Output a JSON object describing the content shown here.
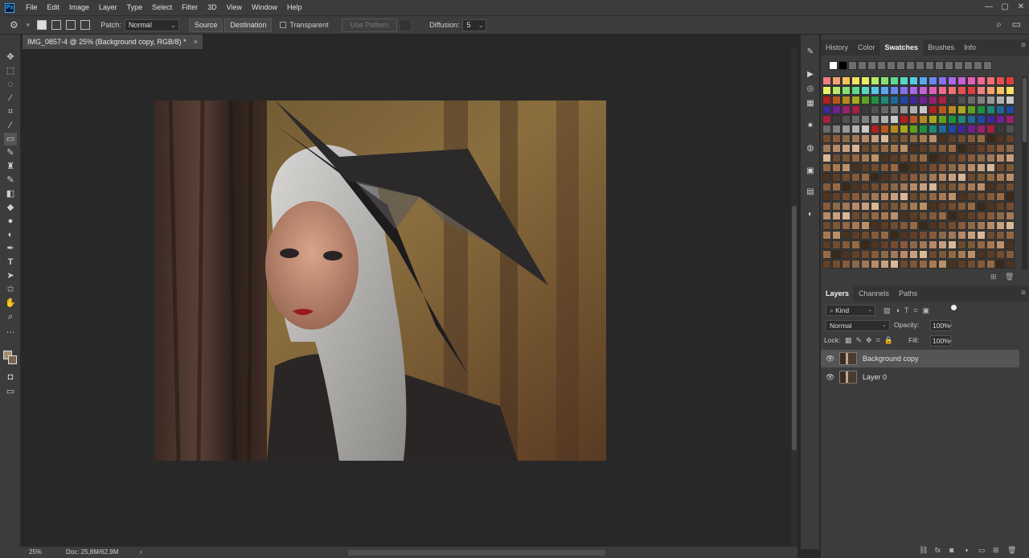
{
  "app": {
    "logo": "Ps"
  },
  "menu": [
    "File",
    "Edit",
    "Image",
    "Layer",
    "Type",
    "Select",
    "Filter",
    "3D",
    "View",
    "Window",
    "Help"
  ],
  "window_controls": {
    "minimize": "—",
    "maximize": "▢",
    "close": "✕"
  },
  "options": {
    "patch_label": "Patch:",
    "patch_mode": "Normal",
    "source": "Source",
    "destination": "Destination",
    "transparent": "Transparent",
    "use_pattern": "Use Pattern",
    "diffusion_label": "Diffusion:",
    "diffusion_value": "5"
  },
  "document": {
    "tab_title": "IMG_0857-4 @ 25% (Background copy, RGB/8) *",
    "close": "×"
  },
  "status": {
    "zoom": "25%",
    "doc": "Doc: 25,8M/62,9M",
    "arrow": "›"
  },
  "swatch_panel": {
    "tabs": [
      "History",
      "Color",
      "Swatches",
      "Brushes",
      "Info"
    ],
    "active_tab": "Swatches",
    "recent": [
      "#ffffff",
      "#000000",
      "#6d6d6d",
      "#6d6d6d",
      "#6d6d6d",
      "#6d6d6d",
      "#6d6d6d",
      "#6d6d6d",
      "#6d6d6d",
      "#6d6d6d",
      "#6d6d6d",
      "#6d6d6d",
      "#6d6d6d",
      "#6d6d6d",
      "#6d6d6d",
      "#6d6d6d",
      "#6d6d6d"
    ]
  },
  "layers_panel": {
    "tabs": [
      "Layers",
      "Channels",
      "Paths"
    ],
    "active_tab": "Layers",
    "filter": "Kind",
    "blend": "Normal",
    "opacity_label": "Opacity:",
    "opacity": "100%",
    "lock_label": "Lock:",
    "fill_label": "Fill:",
    "fill": "100%",
    "layers": [
      {
        "name": "Background copy",
        "selected": true
      },
      {
        "name": "Layer 0",
        "selected": false
      }
    ]
  },
  "colors": {
    "accent": "#31a8ff",
    "panel_bg": "#3c3c3c",
    "canvas_bg": "#282828"
  }
}
